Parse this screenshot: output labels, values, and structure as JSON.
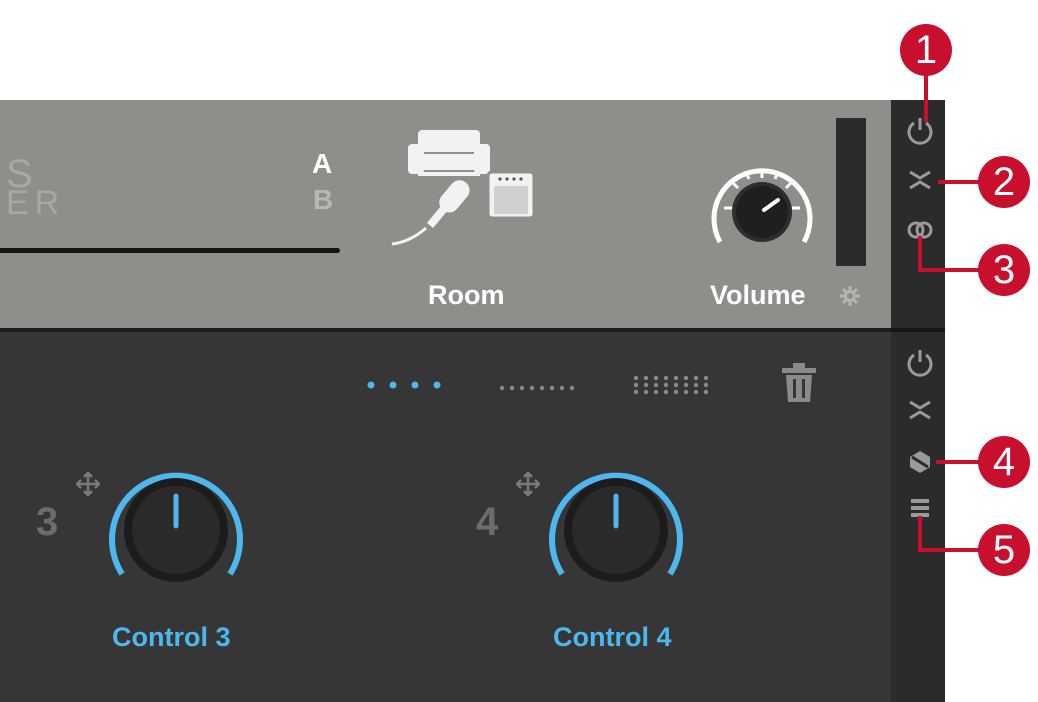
{
  "top": {
    "logo_line1": "S",
    "logo_line2": "ER",
    "a_label": "A",
    "b_label": "B",
    "room_label": "Room",
    "volume_label": "Volume"
  },
  "bottom": {
    "control3_number": "3",
    "control3_label": "Control 3",
    "control4_number": "4",
    "control4_label": "Control 4"
  },
  "callouts": [
    "1",
    "2",
    "3",
    "4",
    "5"
  ],
  "colors": {
    "top_panel": "#8f8e8a",
    "bottom_panel": "#363636",
    "sidebar": "#2b2b2b",
    "accent_blue": "#4db8ee",
    "callout_red": "#c8102e"
  },
  "icons": {
    "top_sidebar": [
      "power-icon",
      "collapse-icon",
      "link-rings-icon"
    ],
    "bottom_sidebar": [
      "power-icon",
      "collapse-icon",
      "hexagon-icon",
      "list-icon"
    ],
    "page_selectors": [
      "four-dots-icon",
      "eight-dots-icon",
      "sixteen-dots-icon"
    ],
    "delete": "trash-icon"
  }
}
